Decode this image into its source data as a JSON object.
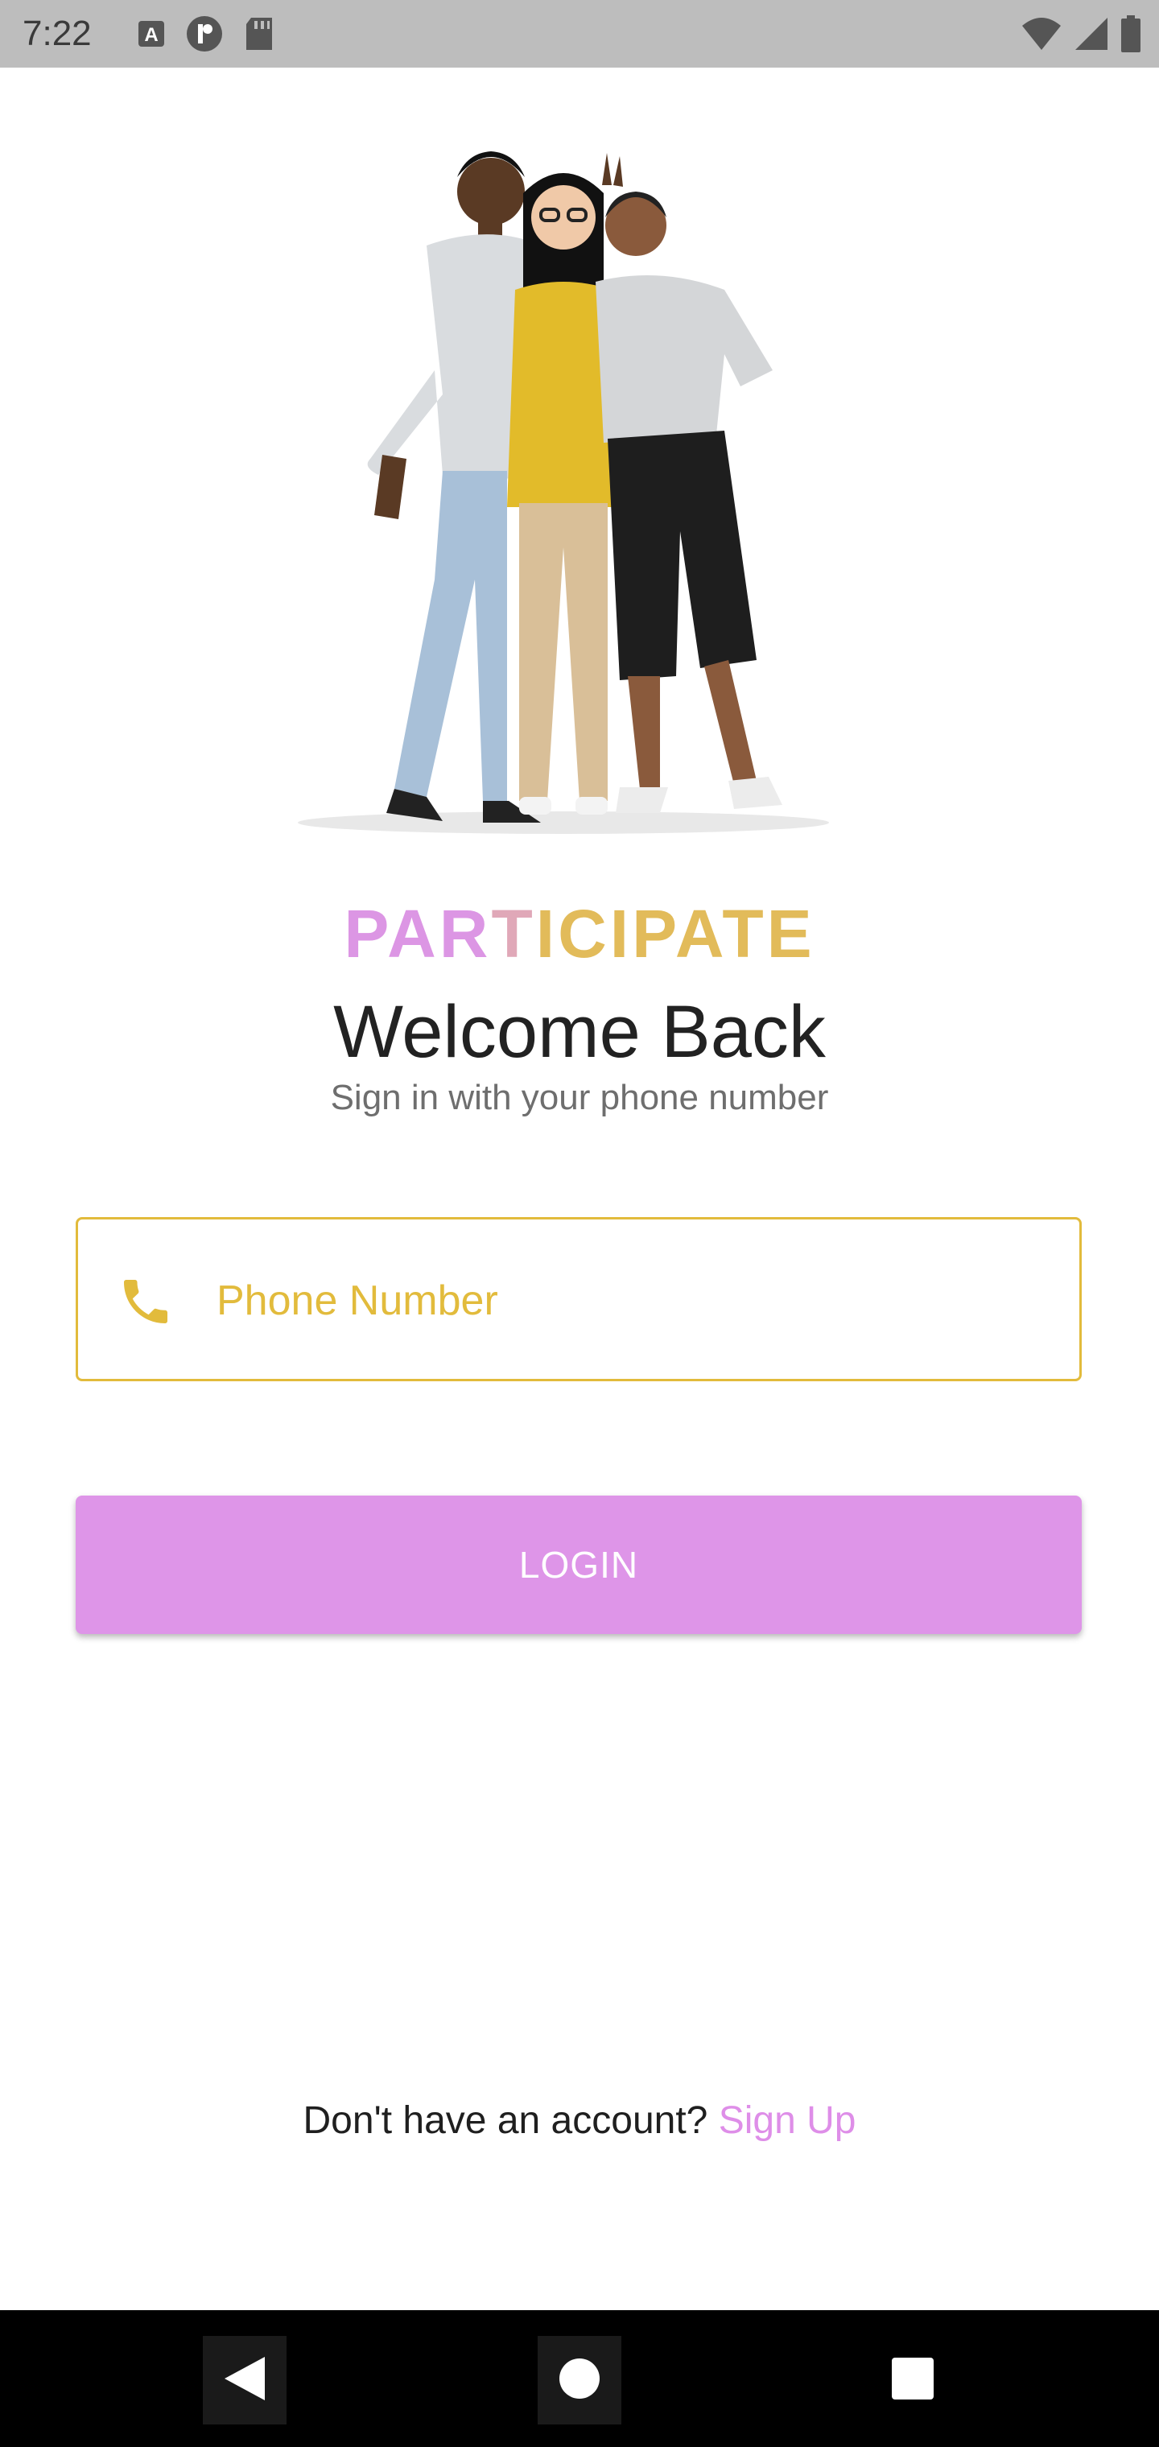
{
  "status_bar": {
    "time": "7:22",
    "left_icons": [
      "a-notification-icon",
      "circle-p-notification-icon",
      "sd-card-icon"
    ],
    "right_icons": [
      "wifi-icon",
      "signal-icon",
      "battery-icon"
    ]
  },
  "hero": {
    "image": "three-people-illustration"
  },
  "brand": {
    "part1": "PAR",
    "part2": "T",
    "part3": "ICIPATE"
  },
  "welcome": {
    "title": "Welcome Back",
    "subtitle": "Sign in with your phone number"
  },
  "form": {
    "phone_placeholder": "Phone Number",
    "phone_value": "",
    "phone_icon": "phone-icon",
    "login_label": "LOGIN"
  },
  "signup": {
    "prompt": "Don't have an account? ",
    "link": "Sign Up"
  },
  "nav": {
    "back": "back-icon",
    "home": "home-icon",
    "recents": "recents-icon"
  },
  "colors": {
    "accent_gold": "#e2bb3c",
    "accent_pink": "#de95e8",
    "status_bar": "#bdbdbd"
  }
}
